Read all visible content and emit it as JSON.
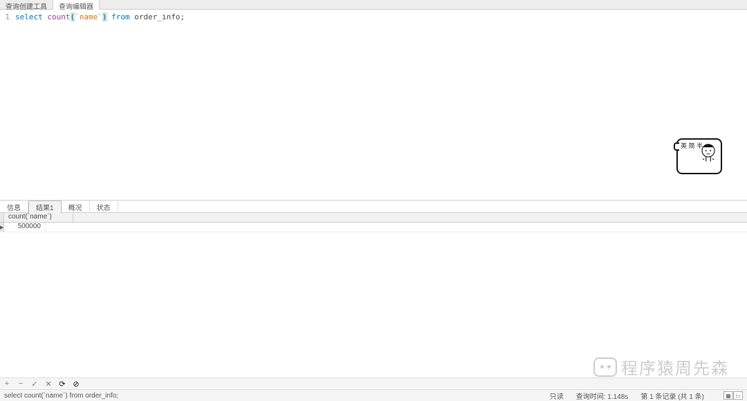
{
  "top_tabs": [
    {
      "label": "查询创建工具",
      "active": false
    },
    {
      "label": "查询编辑器",
      "active": true
    }
  ],
  "editor": {
    "line_number": "1",
    "tokens": {
      "select": "select",
      "count": "count",
      "lparen": "(",
      "backtick1": "`",
      "name": "name",
      "backtick2": "`",
      "rparen": ")",
      "from": "from",
      "table": "order_info",
      "semi": ";"
    }
  },
  "result_tabs": [
    {
      "label": "信息",
      "active": false
    },
    {
      "label": "结果1",
      "active": true
    },
    {
      "label": "概况",
      "active": false
    },
    {
      "label": "状态",
      "active": false
    }
  ],
  "grid": {
    "columns": [
      "count(`name`)"
    ],
    "rows": [
      {
        "marker": "▶",
        "cells": [
          "500000"
        ]
      }
    ]
  },
  "toolbar": {
    "i1": "+",
    "i2": "−",
    "i3": "✓",
    "i4": "✕",
    "i5": "⟳",
    "i6": "⊘"
  },
  "status": {
    "sql": "select count(`name`) from order_info;",
    "readonly": "只读",
    "query_time": "查询时间: 1.148s",
    "records": "第 1 条记录 (共 1 条)"
  },
  "sticker": {
    "text": "英\n简\n半\n♥"
  },
  "watermark": "程序猿周先森"
}
